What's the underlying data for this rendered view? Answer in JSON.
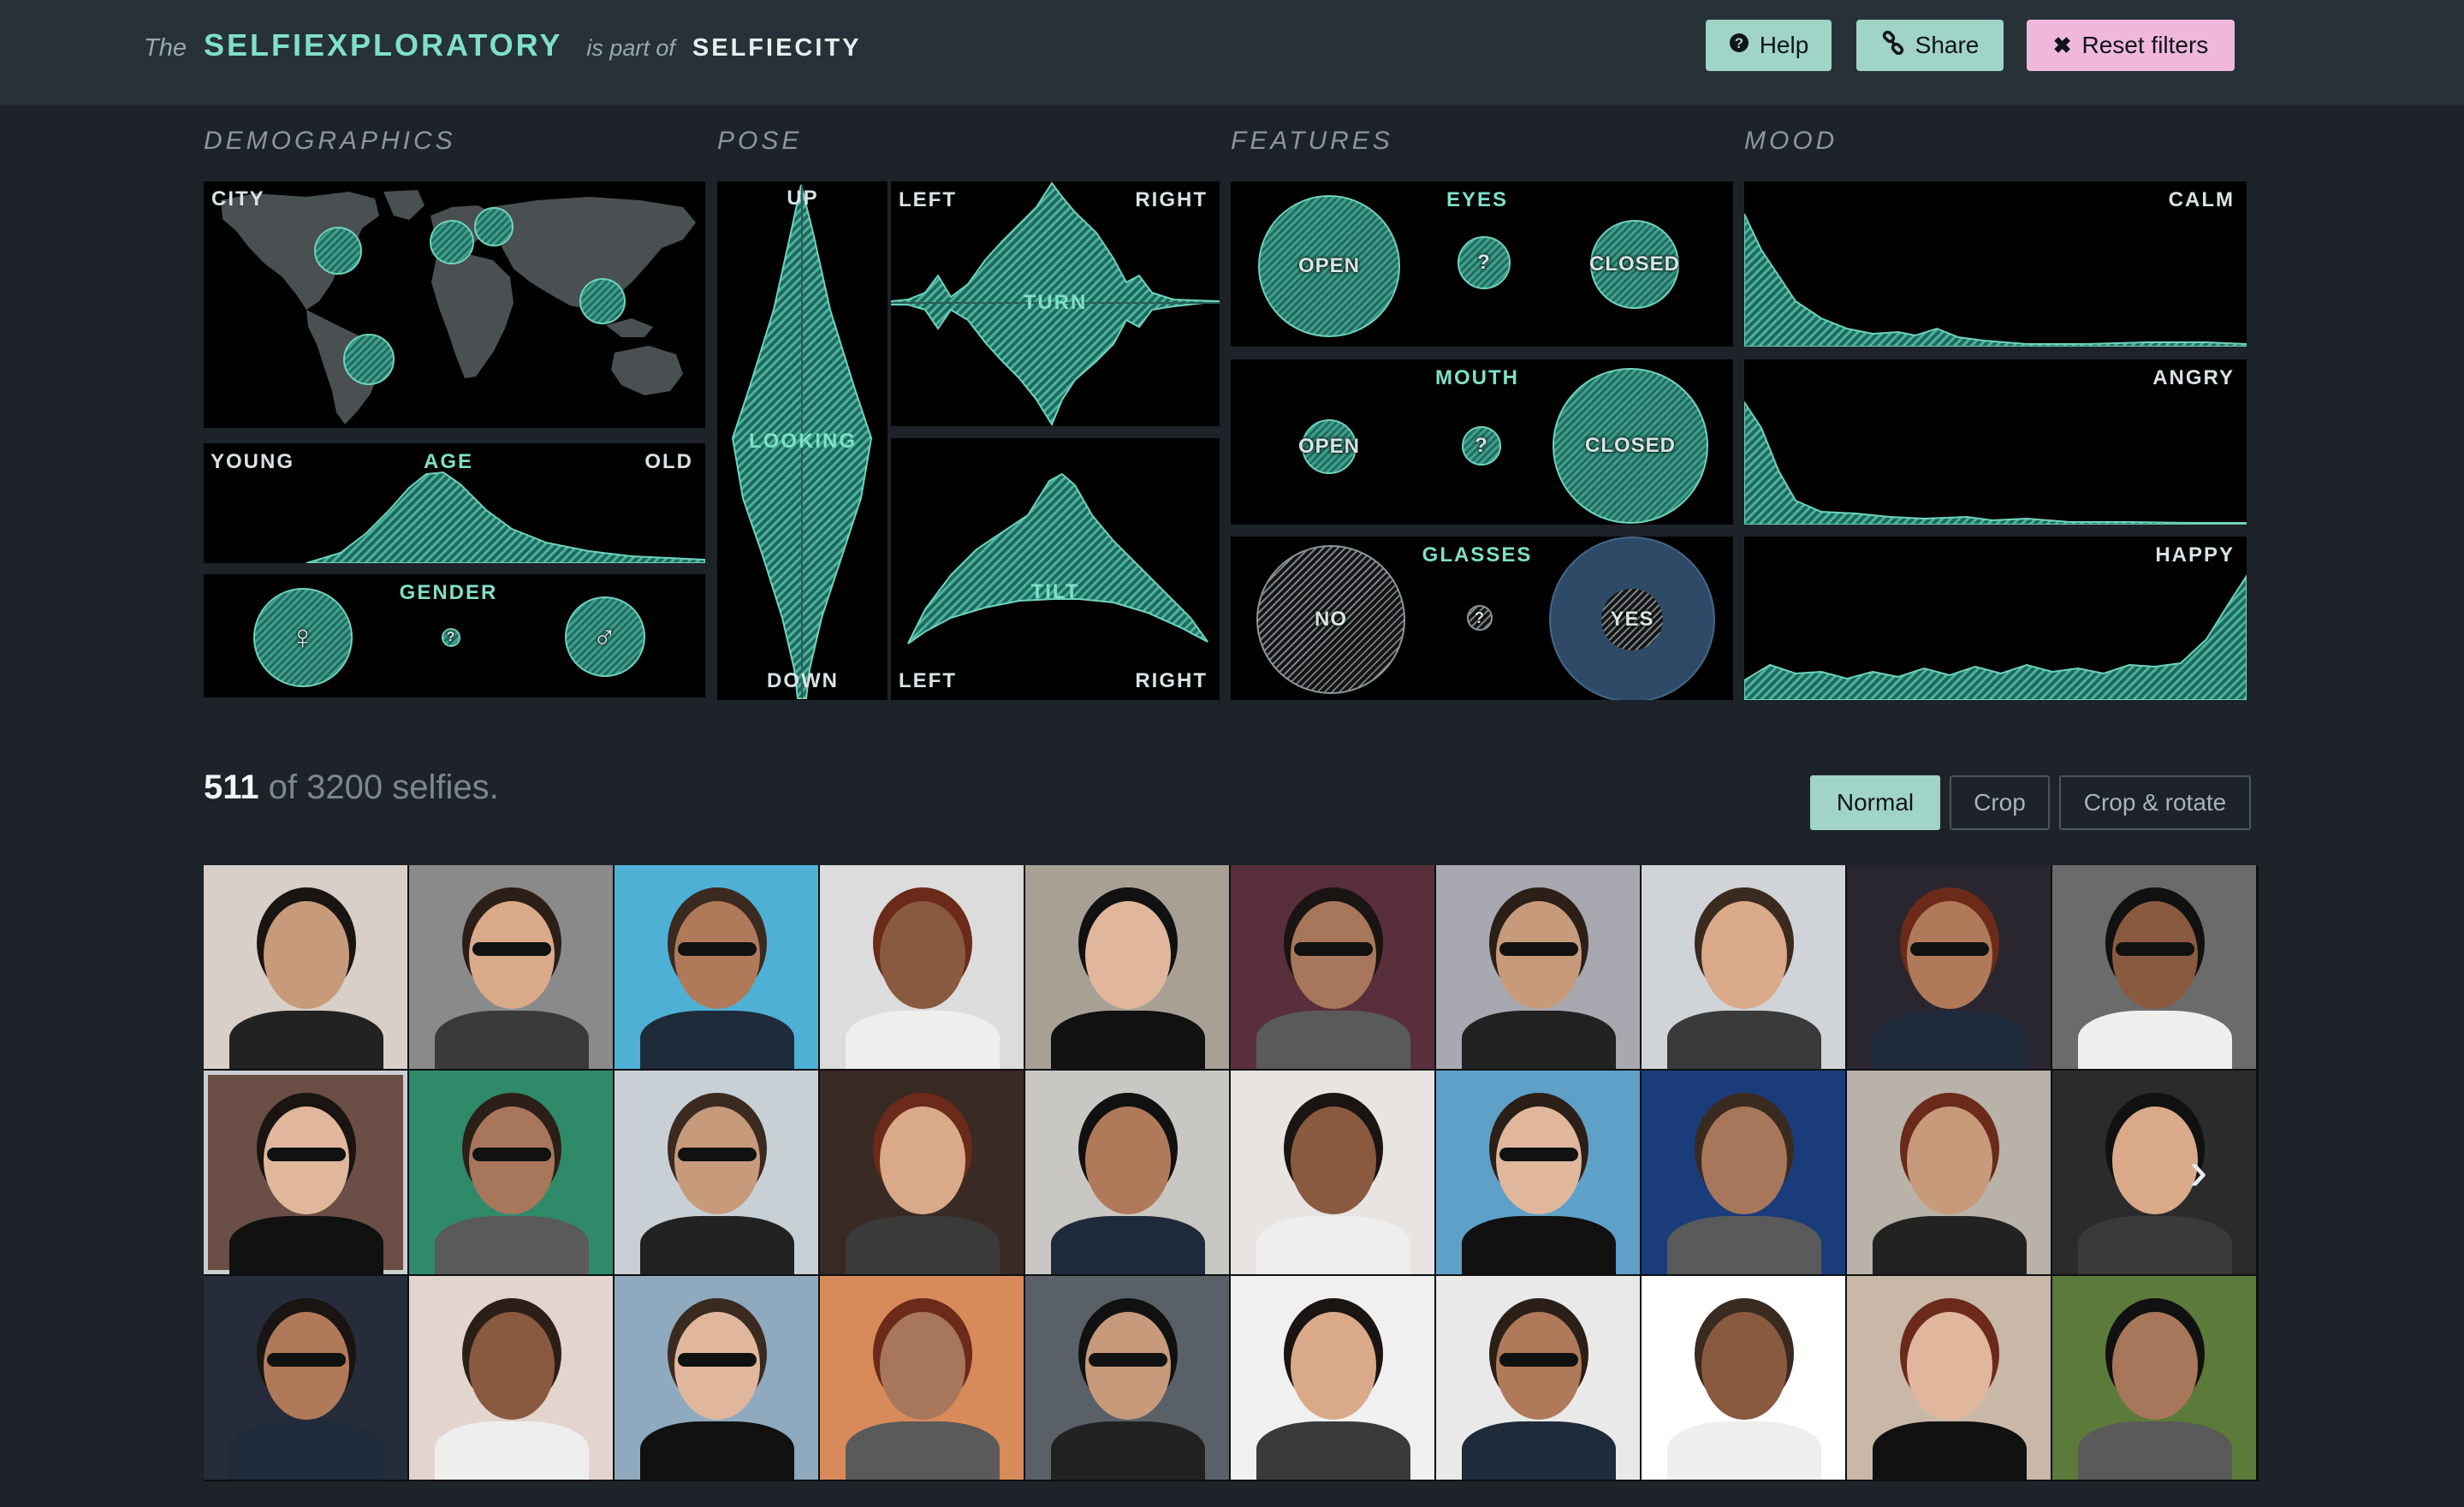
{
  "header": {
    "the": "The",
    "app_name": "SELFIEXPLORATORY",
    "is_part_of": "is part of",
    "parent_name": "SELFIECITY",
    "help_label": "Help",
    "share_label": "Share",
    "reset_label": "Reset filters"
  },
  "sections": {
    "demographics": "DEMOGRAPHICS",
    "pose": "POSE",
    "features": "FEATURES",
    "mood": "MOOD"
  },
  "demographics": {
    "city_label": "CITY",
    "age": {
      "label": "AGE",
      "left": "YOUNG",
      "right": "OLD"
    },
    "gender": {
      "label": "GENDER",
      "female_symbol": "♀",
      "unknown_symbol": "?",
      "male_symbol": "♂"
    }
  },
  "pose": {
    "looking": {
      "label": "LOOKING",
      "top": "UP",
      "bottom": "DOWN"
    },
    "turn": {
      "label": "TURN",
      "left": "LEFT",
      "right": "RIGHT"
    },
    "tilt": {
      "label": "TILT",
      "left": "LEFT",
      "right": "RIGHT"
    }
  },
  "features": {
    "eyes": {
      "label": "EYES",
      "open": "OPEN",
      "unknown": "?",
      "closed": "CLOSED"
    },
    "mouth": {
      "label": "MOUTH",
      "open": "OPEN",
      "unknown": "?",
      "closed": "CLOSED"
    },
    "glasses": {
      "label": "GLASSES",
      "no": "NO",
      "unknown": "?",
      "yes": "YES"
    }
  },
  "mood": {
    "calm": "CALM",
    "angry": "ANGRY",
    "happy": "HAPPY"
  },
  "results": {
    "count": "511",
    "count_suffix": "of 3200 selfies.",
    "view_modes": [
      "Normal",
      "Crop",
      "Crop & rotate"
    ],
    "active_view": "Normal"
  },
  "colors": {
    "accent": "#7fe0c8",
    "header_bg": "#263138",
    "page_bg": "#1d2329",
    "button_teal": "#9fd4c6",
    "button_pink": "#f0b7dd",
    "glasses_yes": "#2e4a66"
  },
  "icons": {
    "help": "question-circle-icon",
    "share": "link-icon",
    "reset": "close-icon",
    "next": "chevron-right-icon"
  }
}
